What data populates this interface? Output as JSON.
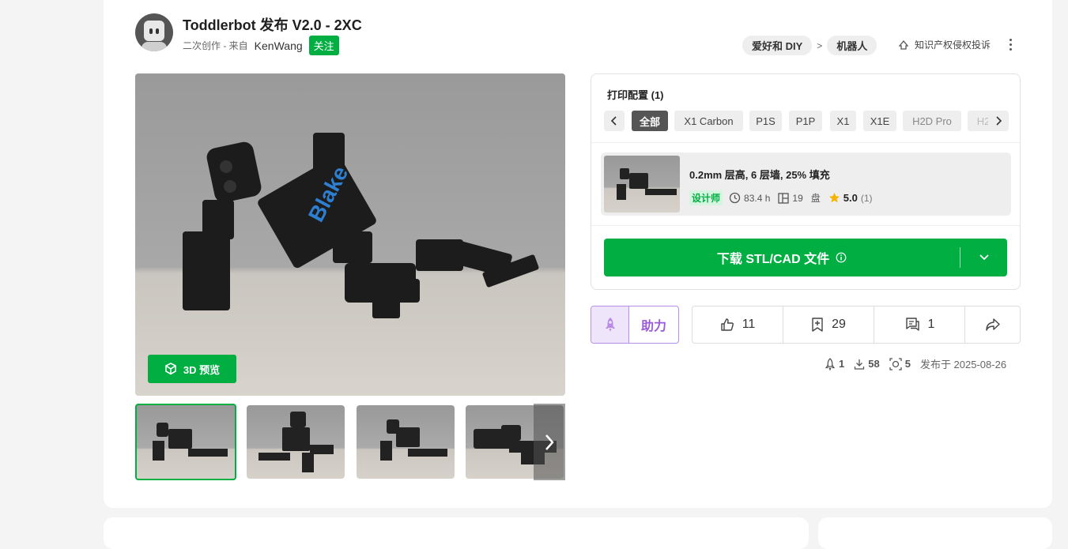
{
  "header": {
    "title": "Toddlerbot 发布 V2.0 - 2XC",
    "remix_text": "二次创作 - 来自",
    "author": "KenWang",
    "follow_label": "关注"
  },
  "breadcrumb": {
    "items": [
      "爱好和 DIY",
      "机器人"
    ],
    "separator": ">"
  },
  "report_label": "知识产权侵权投诉",
  "gallery": {
    "preview_label": "3D 预览"
  },
  "print_profiles": {
    "title": "打印配置 (1)",
    "filters": [
      "全部",
      "X1 Carbon",
      "P1S",
      "P1P",
      "X1",
      "X1E",
      "H2D Pro",
      "H2"
    ],
    "selected_filter": "全部",
    "profile": {
      "name": "0.2mm 层高, 6 层墙, 25% 填充",
      "badge": "设计师",
      "time": "83.4 h",
      "plates": "19",
      "plate_unit": "盘",
      "rating": "5.0",
      "rating_count": "(1)"
    },
    "download_label": "下载 STL/CAD 文件"
  },
  "boost_label": "助力",
  "actions": {
    "likes": "11",
    "collects": "29",
    "comments": "1"
  },
  "stats": {
    "boosts": "1",
    "downloads": "58",
    "prints": "5",
    "published": "发布于 2025-08-26"
  },
  "colors": {
    "accent": "#00ae42",
    "boost": "#9a5bd9"
  }
}
